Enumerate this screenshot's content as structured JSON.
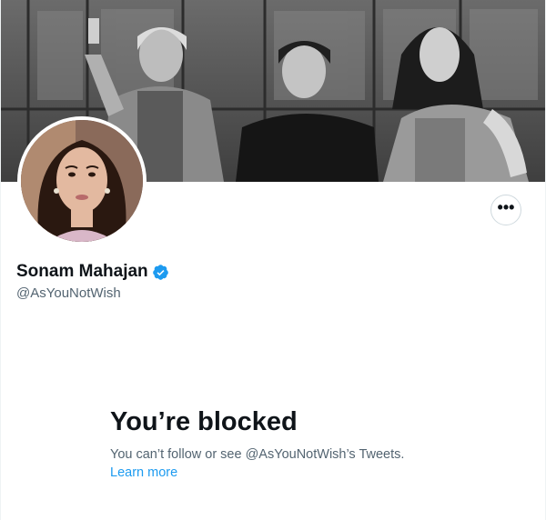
{
  "profile": {
    "display_name": "Sonam Mahajan",
    "handle": "@AsYouNotWish",
    "verified": true,
    "banner_icon": "banner-photo",
    "avatar_icon": "profile-photo"
  },
  "actions": {
    "more_label": "•••",
    "more_icon": "more-horizontal-icon"
  },
  "blocked": {
    "title": "You’re blocked",
    "message": "You can’t follow or see @AsYouNotWish’s Tweets.",
    "link": "Learn more"
  },
  "colors": {
    "accent": "#1d9bf0",
    "text_primary": "#0f1419",
    "text_secondary": "#536471",
    "border": "#cfd9de"
  }
}
